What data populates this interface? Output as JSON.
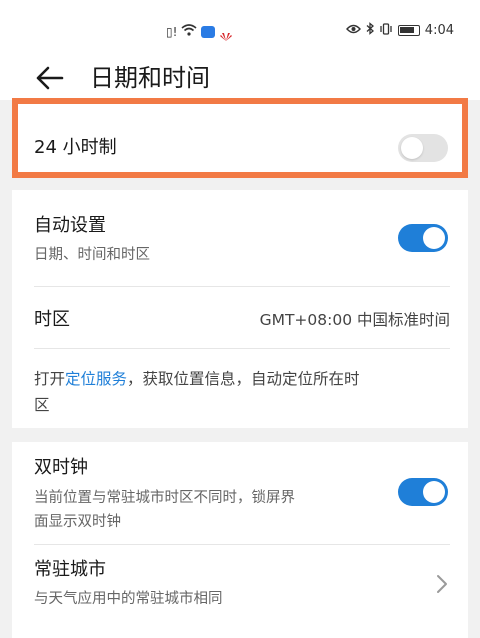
{
  "status_bar": {
    "time": "4:04"
  },
  "header": {
    "title": "日期和时间"
  },
  "settings": {
    "hour24": {
      "label": "24 小时制",
      "enabled": false
    },
    "auto_set": {
      "title": "自动设置",
      "subtitle": "日期、时间和时区",
      "enabled": true
    },
    "timezone": {
      "title": "时区",
      "value": "GMT+08:00 中国标准时间"
    },
    "location_hint": {
      "prefix": "打开",
      "link": "定位服务",
      "suffix_line1": "，获取位置信息，自动定位所在时",
      "line2": "区"
    },
    "dual_clock": {
      "title": "双时钟",
      "subtitle_line1": "当前位置与常驻城市时区不同时，锁屏界",
      "subtitle_line2": "面显示双时钟",
      "enabled": true
    },
    "home_city": {
      "title": "常驻城市",
      "subtitle": "与天气应用中的常驻城市相同"
    }
  },
  "colors": {
    "accent": "#1f7fd8",
    "highlight": "#f27a45",
    "background": "#f1f1f1",
    "toggle_off": "#e3e3e3"
  }
}
